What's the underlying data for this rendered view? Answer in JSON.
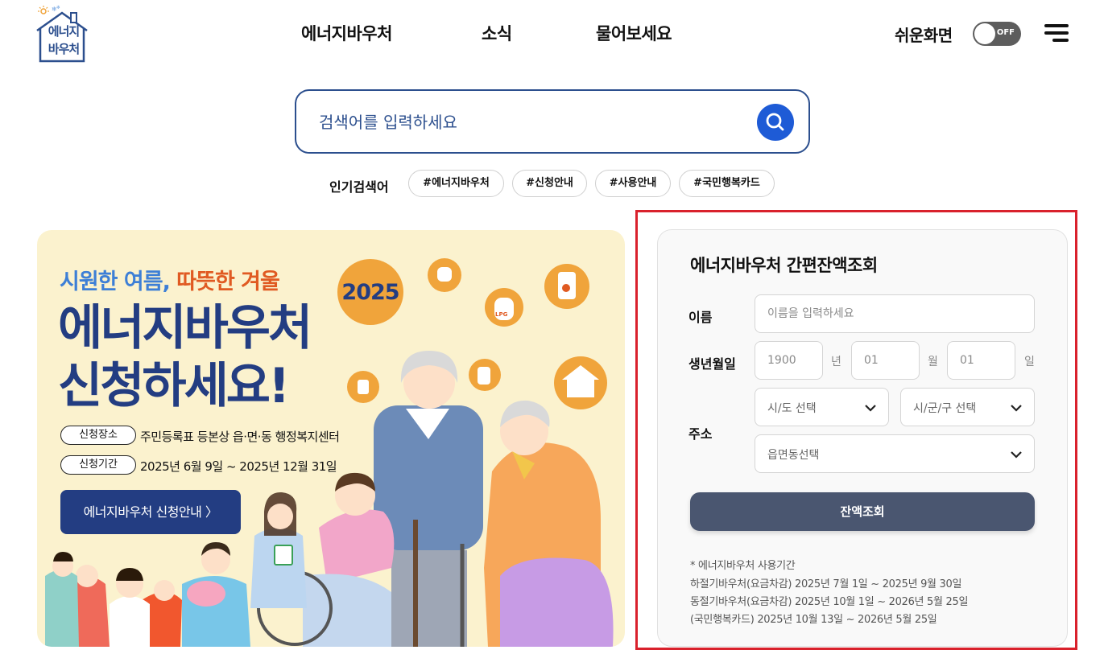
{
  "header": {
    "logo_text": "에너지\n바우처",
    "nav": [
      "에너지바우처",
      "소식",
      "물어보세요"
    ],
    "easy_screen_label": "쉬운화면",
    "toggle_state": "OFF"
  },
  "search": {
    "placeholder": "검색어를 입력하세요",
    "popular_label": "인기검색어",
    "tags": [
      "#에너지바우처",
      "#신청안내",
      "#사용안내",
      "#국민행복카드"
    ]
  },
  "banner": {
    "subtitle_blue": "시원한 여름,",
    "subtitle_orange": "따뜻한 겨울",
    "title_line1": "에너지바우처",
    "title_line2": "신청하세요!",
    "year": "2025",
    "place_label": "신청장소",
    "place_text": "주민등록표 등본상 읍·면·동 행정복지센터",
    "period_label": "신청기간",
    "period_text": "2025년 6월 9일 ~ 2025년 12월 31일",
    "button_label": "에너지바우처 신청안내 〉",
    "icon_lpg": "LPG"
  },
  "balance": {
    "title": "에너지바우처 간편잔액조회",
    "name_label": "이름",
    "name_placeholder": "이름을 입력하세요",
    "birth_label": "생년월일",
    "birth_year": "1900",
    "birth_month": "01",
    "birth_day": "01",
    "unit_year": "년",
    "unit_month": "월",
    "unit_day": "일",
    "address_label": "주소",
    "sido_select": "시/도 선택",
    "sigungu_select": "시/군/구 선택",
    "emd_select": "읍면동선택",
    "query_button": "잔액조회",
    "notes": [
      "* 에너지바우처 사용기간",
      "하절기바우처(요금차감) 2025년 7월 1일 ~ 2025년 9월 30일",
      "동절기바우처(요금차감) 2025년 10월 1일 ~ 2026년 5월 25일",
      "(국민행복카드) 2025년 10월 13일 ~ 2026년 5월 25일"
    ]
  },
  "colors": {
    "brand_navy": "#233d82",
    "search_blue": "#1e5bd6",
    "banner_bg": "#fbf2ce",
    "accent_orange": "#f0a43b",
    "highlight_red": "#d9212c",
    "query_button": "#4a5670"
  }
}
